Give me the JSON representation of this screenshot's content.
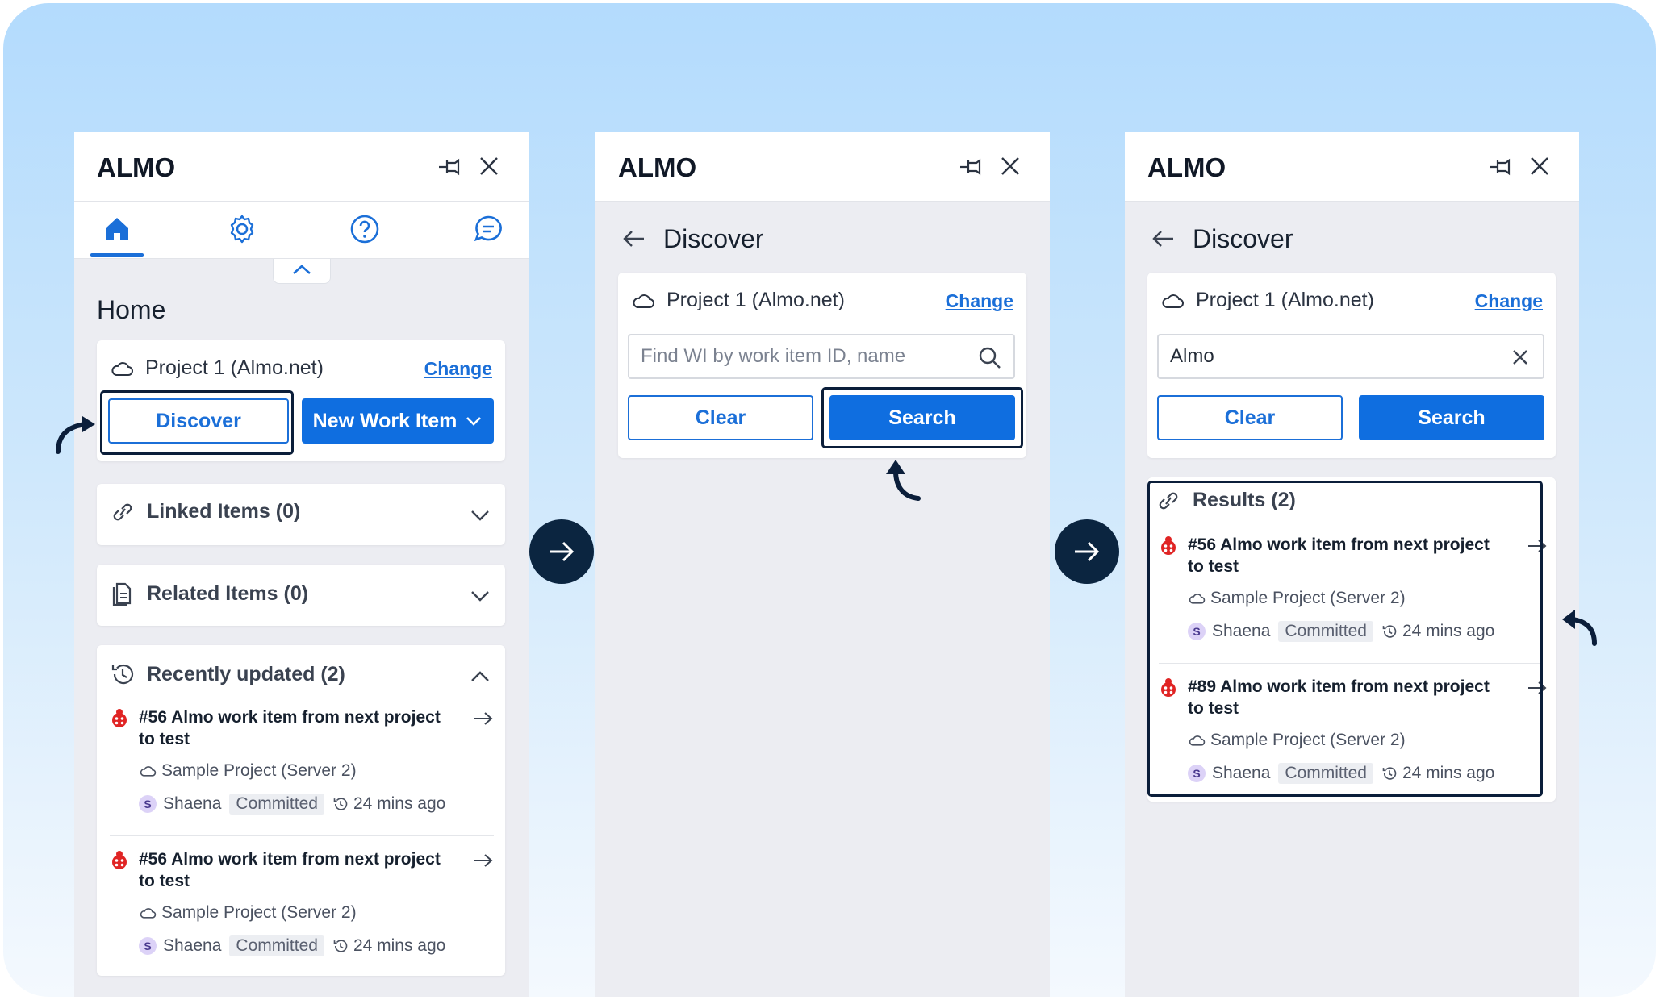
{
  "brand": {
    "logo": "ALMO"
  },
  "panel1": {
    "tabs": [
      "home-icon",
      "gear-icon",
      "help-icon",
      "chat-icon"
    ],
    "page_title": "Home",
    "project": "Project 1 (Almo.net)",
    "change_label": "Change",
    "discover_label": "Discover",
    "new_work_item_label": "New Work Item",
    "linked_items": "Linked Items (0)",
    "related_items": "Related Items (0)",
    "recently_updated": "Recently updated (2)",
    "items": [
      {
        "title": "#56 Almo work item from next project to test",
        "project": "Sample Project (Server 2)",
        "avatar": "S",
        "user": "Shaena",
        "state": "Committed",
        "time": "24 mins ago"
      },
      {
        "title": "#56 Almo work item from next project to test",
        "project": "Sample Project (Server 2)",
        "avatar": "S",
        "user": "Shaena",
        "state": "Committed",
        "time": "24 mins ago"
      }
    ]
  },
  "panel2": {
    "page_title": "Discover",
    "project": "Project 1 (Almo.net)",
    "change_label": "Change",
    "search_placeholder": "Find WI by work item ID, name",
    "clear_label": "Clear",
    "search_label": "Search"
  },
  "panel3": {
    "page_title": "Discover",
    "project": "Project 1 (Almo.net)",
    "change_label": "Change",
    "search_value": "Almo",
    "clear_label": "Clear",
    "search_label": "Search",
    "results_title": "Results (2)",
    "items": [
      {
        "title": "#56 Almo work item from next project to test",
        "project": "Sample Project (Server 2)",
        "avatar": "S",
        "user": "Shaena",
        "state": "Committed",
        "time": "24 mins ago"
      },
      {
        "title": "#89 Almo work item from next project to test",
        "project": "Sample Project (Server 2)",
        "avatar": "S",
        "user": "Shaena",
        "state": "Committed",
        "time": "24 mins ago"
      }
    ]
  },
  "colors": {
    "accent": "#0f6ee0",
    "highlight_border": "#0b1e3a",
    "bug_red": "#e02424",
    "avatar_bg": "#dcd2f7"
  }
}
